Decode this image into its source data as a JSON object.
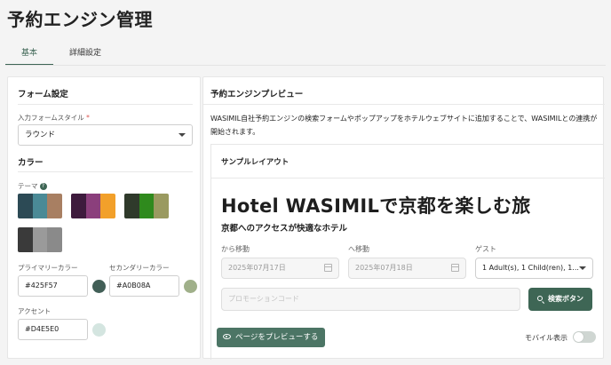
{
  "page_title": "予約エンジン管理",
  "tabs": [
    {
      "label": "基本",
      "active": true
    },
    {
      "label": "詳細設定",
      "active": false
    }
  ],
  "form_settings": {
    "title": "フォーム設定",
    "style_label": "入力フォームスタイル",
    "required_mark": "*",
    "style_value": "ラウンド"
  },
  "colors": {
    "title": "カラー",
    "theme_label": "テーマ",
    "help_icon": "question-icon",
    "themes": [
      [
        "#2c4a55",
        "#4a8a96",
        "#a87f62"
      ],
      [
        "#3e1b3d",
        "#8b3f7c",
        "#f2a02a"
      ],
      [
        "#2f3a2b",
        "#2f8a1d",
        "#9a9a60"
      ],
      [
        "#3a3a3a",
        "#9a9a9a",
        "#8a8a8a"
      ]
    ],
    "primary_label": "プライマリーカラー",
    "primary_value": "#425F57",
    "primary_hex": "#425F57",
    "secondary_label": "セカンダリーカラー",
    "secondary_value": "#A0B08A",
    "secondary_hex": "#A0B08A",
    "accent_label": "アクセント",
    "accent_value": "#D4E5E0",
    "accent_hex": "#D4E5E0"
  },
  "preview": {
    "title": "予約エンジンプレビュー",
    "description": "WASIMIL自社予約エンジンの検索フォームやポップアップをホテルウェブサイトに追加することで、WASIMILとの連携が開始されます。",
    "sample_layout_label": "サンプルレイアウト",
    "hotel_title": "Hotel WASIMILで京都を楽しむ旅",
    "hotel_subtitle": "京都へのアクセスが快適なホテル",
    "checkin_label": "から移動",
    "checkin_value": "2025年07月17日",
    "checkout_label": "へ移動",
    "checkout_value": "2025年07月18日",
    "guest_label": "ゲスト",
    "guest_value": "1 Adult(s), 1 Child(ren), 1...",
    "promo_placeholder": "プロモーションコード",
    "search_button": "検索ボタン",
    "preview_button": "ページをプレビューする",
    "mobile_label": "モバイル表示",
    "mobile_on": false
  }
}
